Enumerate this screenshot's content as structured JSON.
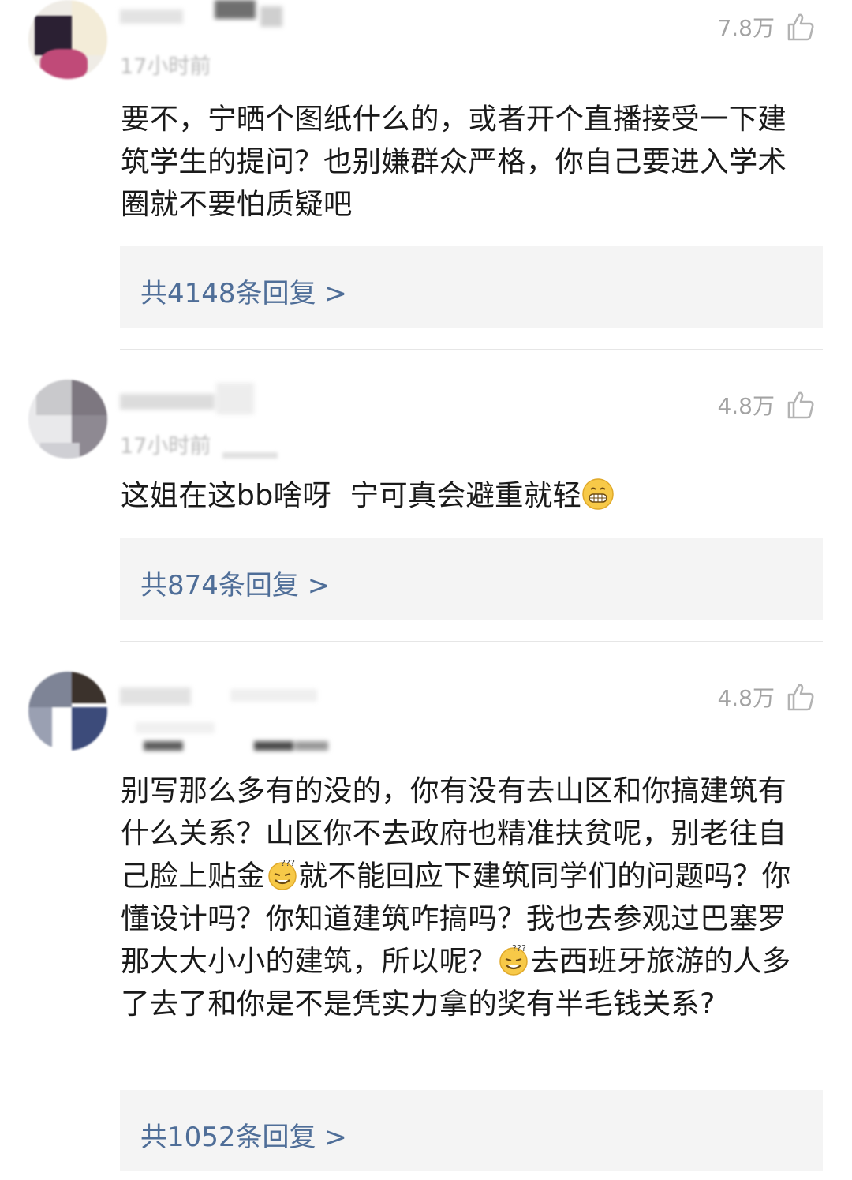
{
  "comments": [
    {
      "time": "17小时前",
      "likes": "7.8万",
      "text": "要不，宁晒个图纸什么的，或者开个直播接受一下建筑学生的提问？也别嫌群众严格，你自己要进入学术圈就不要怕质疑吧",
      "replies": "共4148条回复 >"
    },
    {
      "time": "17小时前",
      "likes": "4.8万",
      "text": "这姐在这bb啥呀  宁可真会避重就轻",
      "replies": "共874条回复 >"
    },
    {
      "likes": "4.8万",
      "text_part1": "别写那么多有的没的，你有没有去山区和你搞建筑有什么关系？山区你不去政府也精准扶贫呢，别老往自己脸上贴金",
      "text_part2": "就不能回应下建筑同学们的问题吗？你懂设计吗？你知道建筑咋搞吗？我也去参观过巴塞罗那大大小小的建筑，所以呢？",
      "text_part3": "去西班牙旅游的人多了去了和你是不是凭实力拿的奖有半毛钱关系?",
      "replies": "共1052条回复 >"
    }
  ]
}
